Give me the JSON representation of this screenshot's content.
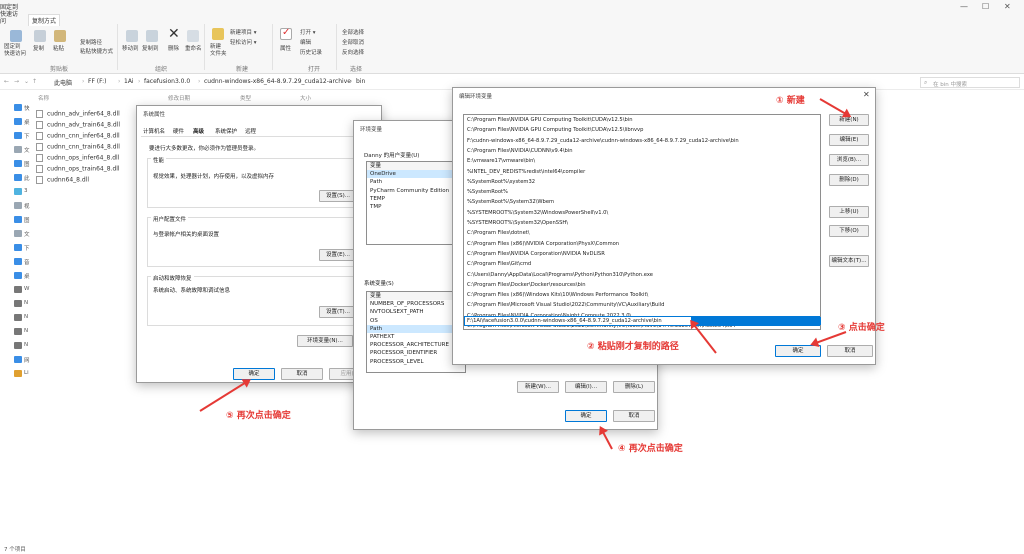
{
  "ribbon": {
    "top_tabs": [
      "固定到",
      "快速访问",
      "复制方式"
    ],
    "buttons": [
      "固定到\n快速访问",
      "复制",
      "粘贴",
      "复制路径",
      "粘贴快捷方式",
      "移动到",
      "复制到",
      "删除",
      "重命名",
      "新建\n文件夹",
      "新建项目 ▾",
      "轻松访问 ▾",
      "属性",
      "打开 ▾",
      "编辑",
      "历史记录",
      "全部选择",
      "全部取消",
      "反向选择"
    ],
    "groups": [
      "剪贴板",
      "组织",
      "新建",
      "打开",
      "选择"
    ],
    "win_controls": [
      "—",
      "☐",
      "✕"
    ]
  },
  "address": {
    "crumbs": [
      "此电脑",
      "FF (F:)",
      "1Ai",
      "facefusion3.0.0",
      "cudnn-windows-x86_64-8.9.7.29_cuda12-archive",
      "bin"
    ],
    "search_placeholder": "在 bin 中搜索"
  },
  "columns": [
    "名称",
    "修改日期",
    "类型",
    "大小"
  ],
  "nav": [
    "快",
    "桌",
    "下",
    "文",
    "图",
    "此",
    "3",
    "视",
    "图",
    "文",
    "下",
    "音",
    "桌",
    "W",
    "N",
    "N",
    "N",
    "N",
    "网",
    "Li"
  ],
  "files": [
    "cudnn_adv_infer64_8.dll",
    "cudnn_adv_train64_8.dll",
    "cudnn_cnn_infer64_8.dll",
    "cudnn_cnn_train64_8.dll",
    "cudnn_ops_infer64_8.dll",
    "cudnn_ops_train64_8.dll",
    "cudnn64_8.dll"
  ],
  "sysprops": {
    "title": "系统属性",
    "tabs": [
      "计算机名",
      "硬件",
      "高级",
      "系统保护",
      "远程"
    ],
    "admin_note": "要进行大多数更改，你必须作为管理员登录。",
    "perf": {
      "title": "性能",
      "desc": "视觉效果，处理器计划，内存使用，以及虚拟内存",
      "btn": "设置(S)..."
    },
    "profile": {
      "title": "用户配置文件",
      "desc": "与登录帐户相关的桌面设置",
      "btn": "设置(E)..."
    },
    "startup": {
      "title": "启动和故障恢复",
      "desc": "系统启动、系统故障和调试信息",
      "btn": "设置(T)..."
    },
    "env_btn": "环境变量(N)...",
    "ok": "确定",
    "cancel": "取消",
    "apply": "应用(A)"
  },
  "envvars": {
    "title": "环境变量",
    "user_label": "Danny 的用户变量(U)",
    "user_header": "变量",
    "user_vars": [
      "OneDrive",
      "Path",
      "PyCharm Community Edition",
      "TEMP",
      "TMP"
    ],
    "sys_label": "系统变量(S)",
    "sys_header": "变量",
    "sys_vars": [
      "NUMBER_OF_PROCESSORS",
      "NVTOOLSEXT_PATH",
      "OS",
      "Path",
      "PATHEXT",
      "PROCESSOR_ARCHITECTURE",
      "PROCESSOR_IDENTIFIER",
      "PROCESSOR_LEVEL"
    ],
    "sys_new": "新建(W)...",
    "sys_edit": "编辑(I)...",
    "sys_delete": "删除(L)",
    "ok": "确定",
    "cancel": "取消"
  },
  "editenv": {
    "title": "编辑环境变量",
    "paths": [
      "C:\\Program Files\\NVIDIA GPU Computing Toolkit\\CUDA\\v12.5\\bin",
      "C:\\Program Files\\NVIDIA GPU Computing Toolkit\\CUDA\\v12.5\\libnvvp",
      "F:\\cudnn-windows-x86_64-8.9.7.29_cuda12-archive\\cudnn-windows-x86_64-8.9.7.29_cuda12-archive\\bin",
      "C:\\Program Files\\NVIDIA\\CUDNN\\v9.4\\bin",
      "E:\\vmware17\\vmware\\bin\\",
      "%INTEL_DEV_REDIST%redist\\intel64\\compiler",
      "%SystemRoot%\\system32",
      "%SystemRoot%",
      "%SystemRoot%\\System32\\Wbem",
      "%SYSTEMROOT%\\System32\\WindowsPowerShell\\v1.0\\",
      "%SYSTEMROOT%\\System32\\OpenSSH\\",
      "C:\\Program Files\\dotnet\\",
      "C:\\Program Files (x86)\\NVIDIA Corporation\\PhysX\\Common",
      "C:\\Program Files\\NVIDIA Corporation\\NVIDIA NvDLISR",
      "C:\\Program Files\\Git\\cmd",
      "C:\\Users\\Danny\\AppData\\Local\\Programs\\Python\\Python310\\Python.exe",
      "C:\\Program Files\\Docker\\Docker\\resources\\bin",
      "C:\\Program Files (x86)\\Windows Kits\\10\\Windows Performance Toolkit\\",
      "C:\\Program Files\\Microsoft Visual Studio\\2022\\Community\\VC\\Auxiliary\\Build",
      "C:\\Program Files\\NVIDIA Corporation\\Nsight Compute 2022.3.0\\",
      "C:\\Program Files\\Microsoft Visual Studio\\2022\\Community\\VC\\Tools\\MSVC\\14.40.33807\\bin\\Hostx64\\x64"
    ],
    "editing": "F:\\1Ai\\facefusion3.0.0\\cudnn-windows-x86_64-8.9.7.29_cuda12-archive\\bin",
    "side_buttons": [
      "新建(N)",
      "编辑(E)",
      "浏览(B)...",
      "删除(D)",
      "上移(U)",
      "下移(O)",
      "编辑文本(T)..."
    ],
    "ok": "确定",
    "cancel": "取消"
  },
  "annotations": {
    "a1": "① 新建",
    "a2": "② 粘贴刚才复制的路径",
    "a3": "③ 点击确定",
    "a4": "④ 再次点击确定",
    "a5": "⑤ 再次点击确定"
  },
  "status": "7 个项目",
  "colors": {
    "annotation": "#e53935",
    "selection": "#0078d7"
  }
}
